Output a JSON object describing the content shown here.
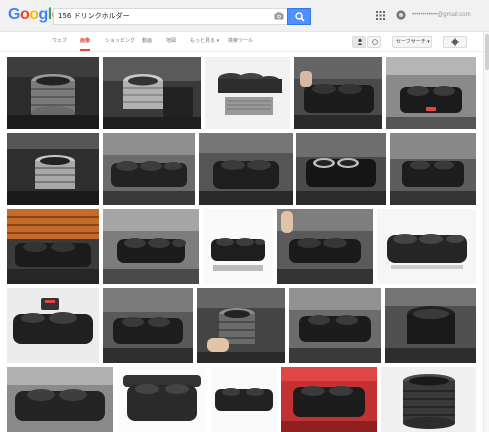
{
  "logo": {
    "letters": [
      "G",
      "o",
      "o",
      "g",
      "l",
      "e"
    ],
    "colors": [
      "#4285f4",
      "#ea4335",
      "#fbbc05",
      "#4285f4",
      "#34a853",
      "#ea4335"
    ]
  },
  "search": {
    "query": "156 ドリンクホルダー"
  },
  "header": {
    "apps_icon": "apps-grid-icon",
    "account_icon": "account-circle-icon",
    "account_email": "••••••••••••@gmail.com"
  },
  "tabs": [
    {
      "label": "ウェブ",
      "active": false
    },
    {
      "label": "画像",
      "active": true
    },
    {
      "label": "ショッピング",
      "active": false
    },
    {
      "label": "動画",
      "active": false
    },
    {
      "label": "地図",
      "active": false
    },
    {
      "label": "もっと見る ▾",
      "active": false
    },
    {
      "label": "検索ツール",
      "active": false
    }
  ],
  "tools": {
    "safe_search_label": "セーフサーチ ▾",
    "gear_icon": "gear-icon"
  },
  "accent": {
    "active_tab": "#dd4b39",
    "search_button": "#4d90fe"
  },
  "results": {
    "description": "Grid of image thumbnails showing black and silver car cup/drink holders"
  }
}
